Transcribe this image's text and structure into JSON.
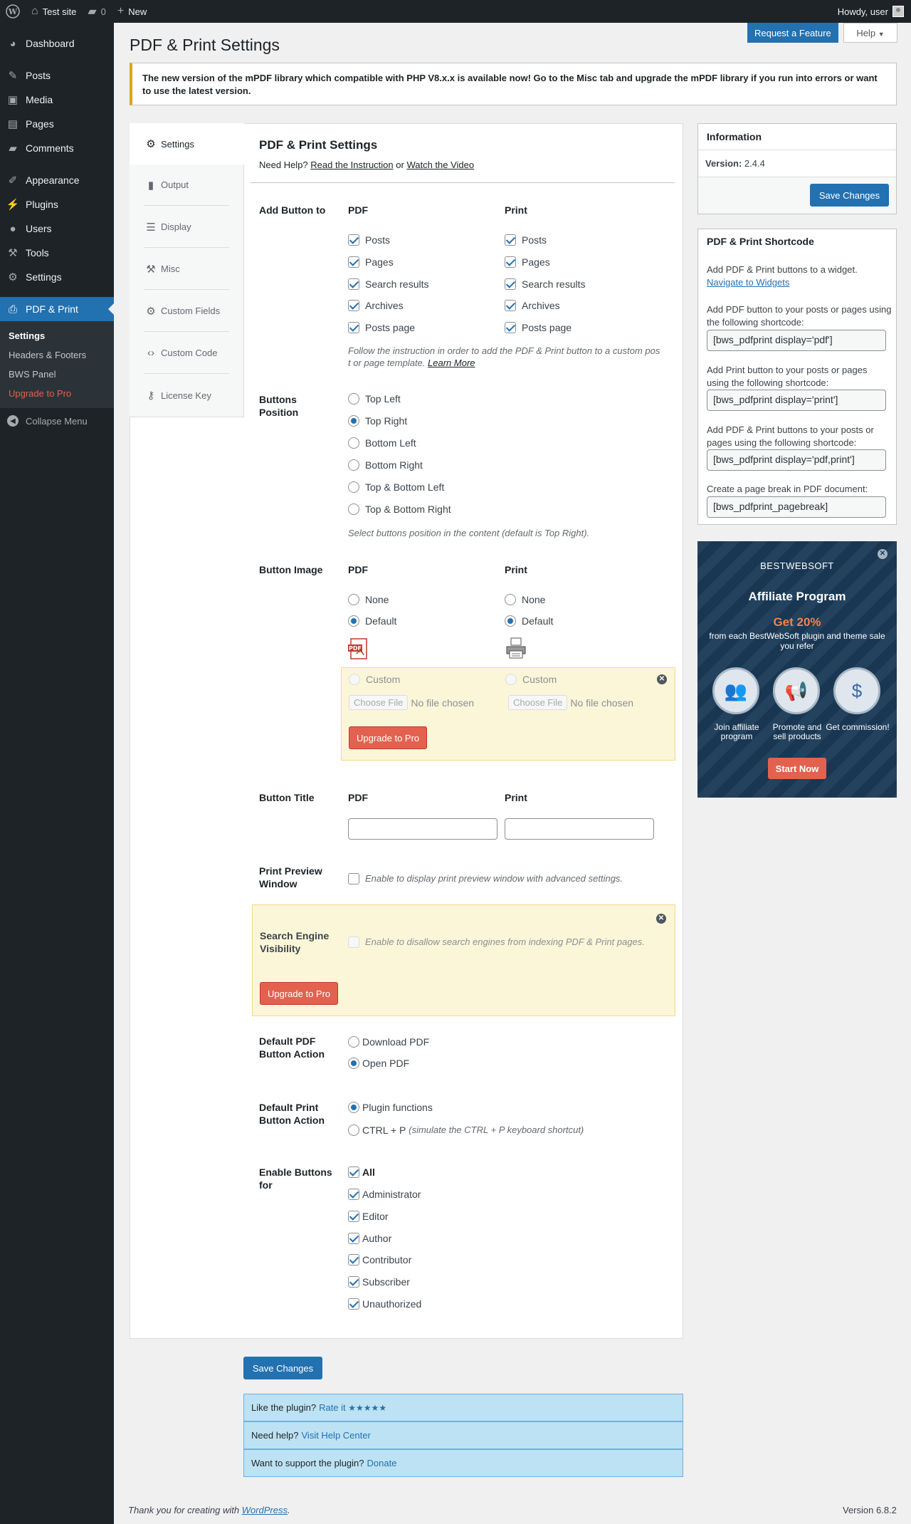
{
  "adminbar": {
    "site": "Test site",
    "comments": "0",
    "new": "New",
    "howdy": "Howdy, user"
  },
  "sidebar": {
    "items": [
      "Dashboard",
      "Posts",
      "Media",
      "Pages",
      "Comments",
      "Appearance",
      "Plugins",
      "Users",
      "Tools",
      "Settings",
      "PDF & Print"
    ],
    "submenu": [
      "Settings",
      "Headers & Footers",
      "BWS Panel",
      "Upgrade to Pro"
    ],
    "collapse": "Collapse Menu"
  },
  "header": {
    "title": "PDF & Print Settings",
    "request_feature": "Request a Feature",
    "help": "Help"
  },
  "notice": "The new version of the mPDF library which compatible with PHP V8.x.x is available now! Go to the Misc tab and upgrade the mPDF library if you run into errors or want to use the latest version.",
  "tabs": [
    "Settings",
    "Output",
    "Display",
    "Misc",
    "Custom Fields",
    "Custom Code",
    "License Key"
  ],
  "settings": {
    "title": "PDF & Print Settings",
    "need_help": "Need Help?",
    "read_instruction": "Read the Instruction",
    "or": "or",
    "watch_video": "Watch the Video",
    "add_button": {
      "label": "Add Button to",
      "pdf_header": "PDF",
      "print_header": "Print",
      "options": [
        "Posts",
        "Pages",
        "Search results",
        "Archives",
        "Posts page"
      ],
      "hint": "Follow the instruction in order to add the PDF & Print button to a custom pos t or page template.",
      "learn_more": "Learn More"
    },
    "position": {
      "label": "Buttons Position",
      "options": [
        "Top Left",
        "Top Right",
        "Bottom Left",
        "Bottom Right",
        "Top & Bottom Left",
        "Top & Bottom Right"
      ],
      "selected": "Top Right",
      "hint": "Select buttons position in the content (default is Top Right)."
    },
    "image": {
      "label": "Button Image",
      "pdf_header": "PDF",
      "print_header": "Print",
      "none": "None",
      "default": "Default",
      "custom": "Custom",
      "choose_file": "Choose File",
      "no_file": "No file chosen",
      "upgrade": "Upgrade to Pro",
      "pdf_icon_text": "PDF"
    },
    "title_row": {
      "label": "Button Title",
      "pdf_header": "PDF",
      "print_header": "Print",
      "pdf_value": "",
      "print_value": ""
    },
    "preview": {
      "label": "Print Preview Window",
      "hint": "Enable to display print preview window with advanced settings."
    },
    "seo": {
      "label": "Search Engine Visibility",
      "hint": "Enable to disallow search engines from indexing PDF & Print pages.",
      "upgrade": "Upgrade to Pro"
    },
    "pdf_action": {
      "label": "Default PDF Button Action",
      "options": [
        "Download PDF",
        "Open PDF"
      ],
      "selected": "Open PDF"
    },
    "print_action": {
      "label": "Default Print Button Action",
      "options": [
        "Plugin functions",
        "CTRL + P"
      ],
      "ctrl_hint": "(simulate the CTRL + P keyboard shortcut)",
      "selected": "Plugin functions"
    },
    "enable_for": {
      "label": "Enable Buttons for",
      "options": [
        "All",
        "Administrator",
        "Editor",
        "Author",
        "Contributor",
        "Subscriber",
        "Unauthorized"
      ]
    },
    "save": "Save Changes"
  },
  "footer_rows": {
    "rate": "Like the plugin?",
    "rate_link": "Rate it",
    "stars": "★★★★★",
    "help": "Need help?",
    "help_link": "Visit Help Center",
    "support": "Want to support the plugin?",
    "support_link": "Donate"
  },
  "info": {
    "title": "Information",
    "version_label": "Version:",
    "version": "2.4.4",
    "save": "Save Changes"
  },
  "shortcode": {
    "title": "PDF & Print Shortcode",
    "widget_text": "Add PDF & Print buttons to a widget.",
    "widget_link": "Navigate to Widgets",
    "pdf_text": "Add PDF button to your posts or pages using the following shortcode:",
    "pdf_code": "[bws_pdfprint display='pdf']",
    "print_text": "Add Print button to your posts or pages using the following shortcode:",
    "print_code": "[bws_pdfprint display='print']",
    "both_text": "Add PDF & Print buttons to your posts or pages using the following shortcode:",
    "both_code": "[bws_pdfprint display='pdf,print']",
    "break_text": "Create a page break in PDF document:",
    "break_code": "[bws_pdfprint_pagebreak]"
  },
  "affiliate": {
    "brand": "BESTWEBSOFT",
    "title": "Affiliate Program",
    "get": "Get 20%",
    "sub": "from each BestWebSoft plugin and theme sale you refer",
    "steps": [
      "Join affiliate program",
      "Promote and sell products",
      "Get commission!"
    ],
    "start": "Start Now"
  },
  "footer": {
    "thanks": "Thank you for creating with",
    "wp": "WordPress",
    "version": "Version 6.8.2"
  },
  "colors": {
    "primary": "#2271b1",
    "admin_dark": "#1d2327",
    "pro_red": "#e2624f",
    "notice_yellow": "#dba617"
  }
}
